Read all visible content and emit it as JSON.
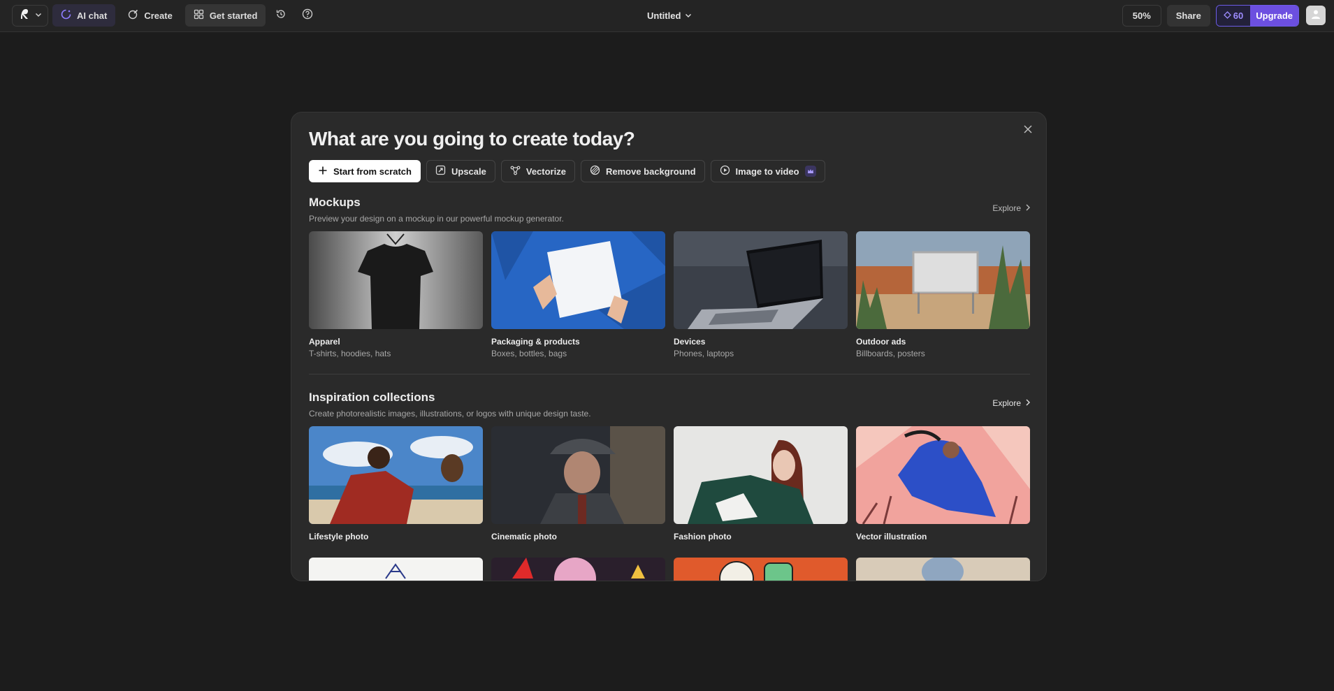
{
  "topbar": {
    "ai_chat": "AI chat",
    "create": "Create",
    "get_started": "Get started",
    "doc_title": "Untitled",
    "zoom": "50%",
    "share": "Share",
    "credits": "60",
    "upgrade": "Upgrade"
  },
  "modal": {
    "title": "What are you going to create today?",
    "actions": [
      {
        "label": "Start from scratch",
        "icon": "plus-icon"
      },
      {
        "label": "Upscale",
        "icon": "upscale-icon"
      },
      {
        "label": "Vectorize",
        "icon": "vectorize-icon"
      },
      {
        "label": "Remove background",
        "icon": "remove-background-icon"
      },
      {
        "label": "Image to video",
        "icon": "play-circle-icon"
      }
    ],
    "mockups": {
      "title": "Mockups",
      "subtitle": "Preview your design on a mockup in our powerful mockup generator.",
      "explore": "Explore",
      "cards": [
        {
          "title": "Apparel",
          "subtitle": "T-shirts, hoodies, hats"
        },
        {
          "title": "Packaging & products",
          "subtitle": "Boxes, bottles, bags"
        },
        {
          "title": "Devices",
          "subtitle": "Phones, laptops"
        },
        {
          "title": "Outdoor ads",
          "subtitle": "Billboards, posters"
        }
      ]
    },
    "inspiration": {
      "title": "Inspiration collections",
      "subtitle": "Create photorealistic images, illustrations, or logos with unique design taste.",
      "explore": "Explore",
      "cards": [
        {
          "title": "Lifestyle photo"
        },
        {
          "title": "Cinematic photo"
        },
        {
          "title": "Fashion photo"
        },
        {
          "title": "Vector illustration"
        }
      ]
    }
  },
  "colors": {
    "background": "#1c1c1c",
    "modal": "#2a2a2a",
    "accent": "#6c4fe0",
    "credits_text": "#9d8cff"
  }
}
